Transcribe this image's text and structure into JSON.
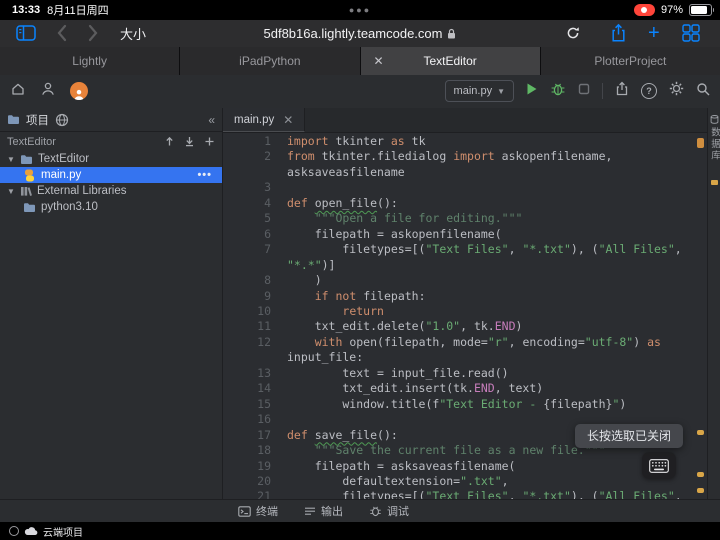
{
  "status_bar": {
    "time": "13:33",
    "date": "8月11日周四",
    "battery_pct": "97%"
  },
  "browser": {
    "toolbar": {
      "font_size_label": "大小",
      "url": "5df8b16a.lightly.teamcode.com"
    },
    "tabs": [
      {
        "label": "Lightly"
      },
      {
        "label": "iPadPython"
      },
      {
        "label": "TextEditor"
      },
      {
        "label": "PlotterProject"
      }
    ]
  },
  "ide": {
    "toolbar": {
      "run_config": "main.py"
    },
    "project_panel": {
      "tab_label": "项目",
      "title": "TextEditor",
      "tree": [
        {
          "label": "TextEditor"
        },
        {
          "label": "main.py"
        },
        {
          "label": "External Libraries"
        },
        {
          "label": "python3.10"
        }
      ]
    },
    "editor": {
      "tab": "main.py",
      "rows": [
        {
          "n": "1",
          "t": [
            [
              "k",
              "import"
            ],
            [
              "p",
              " tkinter "
            ],
            [
              "k",
              "as"
            ],
            [
              "p",
              " tk"
            ]
          ]
        },
        {
          "n": "2",
          "t": [
            [
              "k",
              "from"
            ],
            [
              "p",
              " tkinter.filedialog "
            ],
            [
              "k",
              "import"
            ],
            [
              "p",
              " askopenfilename,"
            ]
          ]
        },
        {
          "n": "",
          "t": [
            [
              "p",
              "asksaveasfilename"
            ]
          ]
        },
        {
          "n": "3",
          "t": []
        },
        {
          "n": "4",
          "t": [
            [
              "k",
              "def"
            ],
            [
              "p",
              " "
            ],
            [
              "f",
              "open_file"
            ],
            [
              "p",
              "():"
            ]
          ]
        },
        {
          "n": "5",
          "t": [
            [
              "p",
              "    "
            ],
            [
              "d",
              "\"\"\"Open a file for editing.\"\"\""
            ]
          ]
        },
        {
          "n": "6",
          "t": [
            [
              "p",
              "    filepath = askopenfilename("
            ]
          ]
        },
        {
          "n": "7",
          "t": [
            [
              "p",
              "        filetypes=[("
            ],
            [
              "s",
              "\"Text Files\""
            ],
            [
              "p",
              ", "
            ],
            [
              "s",
              "\"*.txt\""
            ],
            [
              "p",
              "), ("
            ],
            [
              "s",
              "\"All Files\""
            ],
            [
              "p",
              ","
            ]
          ]
        },
        {
          "n": "",
          "t": [
            [
              "s",
              "\"*.*\""
            ],
            [
              "p",
              ")]"
            ]
          ]
        },
        {
          "n": "8",
          "t": [
            [
              "p",
              "    )"
            ]
          ]
        },
        {
          "n": "9",
          "t": [
            [
              "p",
              "    "
            ],
            [
              "k",
              "if"
            ],
            [
              "p",
              " "
            ],
            [
              "k",
              "not"
            ],
            [
              "p",
              " filepath:"
            ]
          ]
        },
        {
          "n": "10",
          "t": [
            [
              "p",
              "        "
            ],
            [
              "k",
              "return"
            ]
          ]
        },
        {
          "n": "11",
          "t": [
            [
              "p",
              "    txt_edit.delete("
            ],
            [
              "s",
              "\"1.0\""
            ],
            [
              "p",
              ", tk."
            ],
            [
              "c",
              "END"
            ],
            [
              "p",
              ")"
            ]
          ]
        },
        {
          "n": "12",
          "t": [
            [
              "p",
              "    "
            ],
            [
              "k",
              "with"
            ],
            [
              "p",
              " open(filepath, mode="
            ],
            [
              "s",
              "\"r\""
            ],
            [
              "p",
              ", encoding="
            ],
            [
              "s",
              "\"utf-8\""
            ],
            [
              "p",
              ") "
            ],
            [
              "k",
              "as"
            ]
          ]
        },
        {
          "n": "",
          "t": [
            [
              "p",
              "input_file:"
            ]
          ]
        },
        {
          "n": "13",
          "t": [
            [
              "p",
              "        text = input_file.read()"
            ]
          ]
        },
        {
          "n": "14",
          "t": [
            [
              "p",
              "        txt_edit.insert(tk."
            ],
            [
              "c",
              "END"
            ],
            [
              "p",
              ", text)"
            ]
          ]
        },
        {
          "n": "15",
          "t": [
            [
              "p",
              "        window.title(f"
            ],
            [
              "s",
              "\"Text Editor - "
            ],
            [
              "b",
              "{filepath}"
            ],
            [
              "s",
              "\""
            ],
            [
              "p",
              ")"
            ]
          ]
        },
        {
          "n": "16",
          "t": []
        },
        {
          "n": "17",
          "t": [
            [
              "k",
              "def"
            ],
            [
              "p",
              " "
            ],
            [
              "f",
              "save_file"
            ],
            [
              "p",
              "():"
            ]
          ]
        },
        {
          "n": "18",
          "t": [
            [
              "p",
              "    "
            ],
            [
              "d",
              "\"\"\"Save the current file as a new file.\"\"\""
            ]
          ]
        },
        {
          "n": "19",
          "t": [
            [
              "p",
              "    filepath = asksaveasfilename("
            ]
          ]
        },
        {
          "n": "20",
          "t": [
            [
              "p",
              "        defaultextension="
            ],
            [
              "s",
              "\".txt\""
            ],
            [
              "p",
              ","
            ]
          ]
        },
        {
          "n": "21",
          "t": [
            [
              "p",
              "        filetypes=[("
            ],
            [
              "s",
              "\"Text Files\""
            ],
            [
              "p",
              ", "
            ],
            [
              "s",
              "\"*.txt\""
            ],
            [
              "p",
              "), ("
            ],
            [
              "s",
              "\"All Files\""
            ],
            [
              "p",
              ","
            ]
          ]
        }
      ]
    },
    "right_tab": "数据库",
    "toast": "长按选取已关闭",
    "bottom_tabs": [
      {
        "label": "终端"
      },
      {
        "label": "输出"
      },
      {
        "label": "调试"
      }
    ]
  },
  "dock": {
    "label": "云端项目"
  }
}
